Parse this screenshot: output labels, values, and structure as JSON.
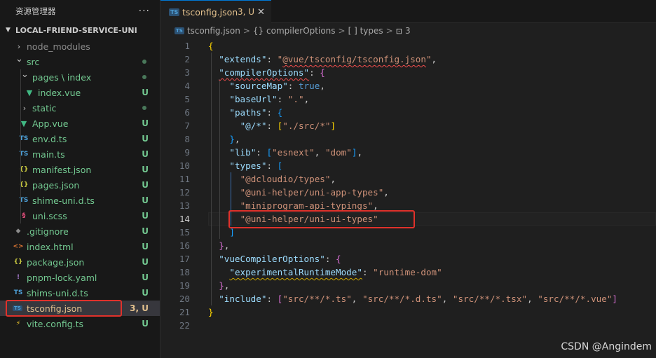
{
  "explorer": {
    "title": "资源管理器",
    "more": "···",
    "project": "LOCAL-FRIEND-SERVICE-UNI",
    "items": [
      {
        "name": "node_modules",
        "kind": "folder",
        "open": false,
        "depth": 1,
        "color": "#8c8c8c",
        "status": "",
        "dot": false
      },
      {
        "name": "src",
        "kind": "folder",
        "open": true,
        "depth": 1,
        "color": "#73c991",
        "status": "",
        "dot": true
      },
      {
        "name": "pages \\ index",
        "kind": "folder",
        "open": true,
        "depth": 2,
        "color": "#73c991",
        "status": "",
        "dot": true
      },
      {
        "name": "index.vue",
        "kind": "vue",
        "depth": 3,
        "color": "#73c991",
        "status": "U",
        "dot": false
      },
      {
        "name": "static",
        "kind": "folder",
        "open": false,
        "depth": 2,
        "color": "#73c991",
        "status": "",
        "dot": true
      },
      {
        "name": "App.vue",
        "kind": "vue",
        "depth": 2,
        "color": "#73c991",
        "status": "U",
        "dot": false
      },
      {
        "name": "env.d.ts",
        "kind": "ts",
        "depth": 2,
        "color": "#73c991",
        "status": "U",
        "dot": false
      },
      {
        "name": "main.ts",
        "kind": "ts",
        "depth": 2,
        "color": "#73c991",
        "status": "U",
        "dot": false
      },
      {
        "name": "manifest.json",
        "kind": "json",
        "depth": 2,
        "color": "#73c991",
        "status": "U",
        "dot": false
      },
      {
        "name": "pages.json",
        "kind": "json",
        "depth": 2,
        "color": "#73c991",
        "status": "U",
        "dot": false
      },
      {
        "name": "shime-uni.d.ts",
        "kind": "ts",
        "depth": 2,
        "color": "#73c991",
        "status": "U",
        "dot": false
      },
      {
        "name": "uni.scss",
        "kind": "scss",
        "depth": 2,
        "color": "#73c991",
        "status": "U",
        "dot": false
      },
      {
        "name": ".gitignore",
        "kind": "git",
        "depth": 1,
        "color": "#73c991",
        "status": "U",
        "dot": false
      },
      {
        "name": "index.html",
        "kind": "html",
        "depth": 1,
        "color": "#73c991",
        "status": "U",
        "dot": false
      },
      {
        "name": "package.json",
        "kind": "json",
        "depth": 1,
        "color": "#73c991",
        "status": "U",
        "dot": false
      },
      {
        "name": "pnpm-lock.yaml",
        "kind": "yaml",
        "depth": 1,
        "color": "#73c991",
        "status": "U",
        "dot": false
      },
      {
        "name": "shims-uni.d.ts",
        "kind": "ts",
        "depth": 1,
        "color": "#73c991",
        "status": "U",
        "dot": false
      },
      {
        "name": "tsconfig.json",
        "kind": "tsconfig",
        "depth": 1,
        "color": "#e2c08d",
        "status": "3, U",
        "dot": false,
        "selected": true
      },
      {
        "name": "vite.config.ts",
        "kind": "vite",
        "depth": 1,
        "color": "#73c991",
        "status": "U",
        "dot": false
      }
    ]
  },
  "tab": {
    "icon": "TS",
    "title": "tsconfig.json",
    "status": "3, U",
    "close": "✕"
  },
  "breadcrumb": {
    "file": "tsconfig.json",
    "seg1": "{} compilerOptions",
    "seg2": "[ ] types",
    "seg3": "3",
    "sep": ">"
  },
  "editor": {
    "current_line": 14,
    "lines": [
      "{",
      "  \"extends\": \"@vue/tsconfig/tsconfig.json\",",
      "  \"compilerOptions\": {",
      "    \"sourceMap\": true,",
      "    \"baseUrl\": \".\",",
      "    \"paths\": {",
      "      \"@/*\": [\"./src/*\"]",
      "    },",
      "    \"lib\": [\"esnext\", \"dom\"],",
      "    \"types\": [",
      "      \"@dcloudio/types\",",
      "      \"@uni-helper/uni-app-types\",",
      "      \"miniprogram-api-typings\",",
      "      \"@uni-helper/uni-ui-types\"",
      "    ]",
      "  },",
      "  \"vueCompilerOptions\": {",
      "    \"experimentalRuntimeMode\": \"runtime-dom\"",
      "  },",
      "  \"include\": [\"src/**/*.ts\", \"src/**/*.d.ts\", \"src/**/*.tsx\", \"src/**/*.vue\"]",
      "}",
      ""
    ]
  },
  "watermark": "CSDN @Angindem",
  "colors": {
    "accent": "#0078d4",
    "highlight_box": "#e0312b",
    "untracked": "#73c991",
    "modified_error": "#e2c08d"
  }
}
